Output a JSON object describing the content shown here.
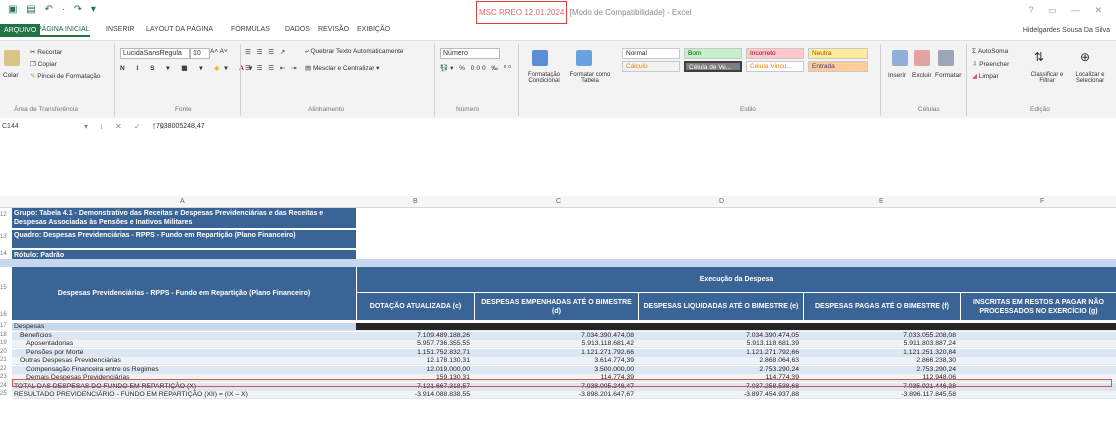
{
  "app": {
    "doc_title_highlight": "MSC RREO 12.01.2024",
    "doc_title_rest": " [Modo de Compatibilidade] - Excel",
    "user": "Hidelgardes Sousa Da Silva",
    "window_controls": "? ▭ — ✕"
  },
  "tabs": [
    "ARQUIVO",
    "PÁGINA INICIAL",
    "INSERIR",
    "LAYOUT DA PÁGINA",
    "FÓRMULAS",
    "DADOS",
    "REVISÃO",
    "EXIBIÇÃO"
  ],
  "ribbon": {
    "clipboard": {
      "cut": "Recortar",
      "copy": "Copiar",
      "paste": "Colar",
      "painter": "Pincel de Formatação",
      "group": "Área de Transferência"
    },
    "font": {
      "name": "LucidaSansRegula",
      "size": "10",
      "group": "Fonte"
    },
    "align": {
      "wrap": "Quebrar Texto Automaticamente",
      "merge": "Mesclar e Centralizar",
      "group": "Alinhamento"
    },
    "number": {
      "format": "Número",
      "group": "Número"
    },
    "styles": {
      "cond": "Formatação Condicional",
      "table": "Formatar como Tabela",
      "normal": "Normal",
      "good": "Bom",
      "bad": "Incorreto",
      "neutral": "Neutra",
      "calc": "Cálculo",
      "check": "Célula de Ve...",
      "linked": "Célula Vincu...",
      "input": "Entrada",
      "group": "Estilo"
    },
    "cells": {
      "insert": "Inserir",
      "delete": "Excluir",
      "format": "Formatar",
      "group": "Células"
    },
    "editing": {
      "autosum": "AutoSoma",
      "fill": "Preencher",
      "clear": "Limpar",
      "sort": "Classificar e Filtrar",
      "find": "Localizar e Selecionar",
      "group": "Edição"
    }
  },
  "formula_bar": {
    "name_box": "C144",
    "formula": "7038005248,47",
    "fx": "fx"
  },
  "columns": [
    "A",
    "B",
    "C",
    "D",
    "E",
    "F"
  ],
  "header_block": {
    "row_numbers": [
      "12",
      "13",
      "14"
    ],
    "group": "Grupo: Tabela 4.1 - Demonstrativo das Receitas e Despesas Previdenciárias e das Receitas e Despesas Associadas às Pensões e Inativos Militares",
    "quadro": "Quadro: Despesas Previdenciárias - RPPS - Fundo em Repartição (Plano Financeiro)",
    "rotulo": "Rótulo: Padrão"
  },
  "table_header": {
    "row_numbers": [
      "15",
      "16"
    ],
    "col_a": "Despesas Previdenciárias - RPPS - Fundo em Repartição (Plano Financeiro)",
    "execucao": "Execução da Despesa",
    "col_b": "DOTAÇÃO ATUALIZADA (c)",
    "col_c": "DESPESAS EMPENHADAS ATÉ O BIMESTRE (d)",
    "col_d": "DESPESAS LIQUIDADAS ATÉ O BIMESTRE (e)",
    "col_e": "DESPESAS PAGAS ATÉ O BIMESTRE (f)",
    "col_f": "INSCRITAS EM RESTOS A PAGAR NÃO PROCESSADOS NO EXERCÍCIO (g)"
  },
  "rows": [
    {
      "n": "17",
      "label": "Despesas",
      "b": "",
      "c": "",
      "d": "",
      "e": "",
      "indent": 0
    },
    {
      "n": "18",
      "label": "Benefícios",
      "b": "7.109.489.188,26",
      "c": "7.034.390.474,08",
      "d": "7.034.390.474,05",
      "e": "7.033.055.208,08",
      "indent": 1
    },
    {
      "n": "19",
      "label": "Aposentadorias",
      "b": "5.957.736.355,55",
      "c": "5.913.118.681,42",
      "d": "5.913.118.681,39",
      "e": "5.911.803.887,24",
      "indent": 2
    },
    {
      "n": "20",
      "label": "Pensões por Morte",
      "b": "1.151.752.832,71",
      "c": "1.121.271.792,66",
      "d": "1.121.271.792,66",
      "e": "1.121.251.320,84",
      "indent": 2
    },
    {
      "n": "21",
      "label": "Outras Despesas Previdenciárias",
      "b": "12.178.130,31",
      "c": "3.614.774,39",
      "d": "2.868.064,63",
      "e": "2.866.238,30",
      "indent": 1
    },
    {
      "n": "22",
      "label": "Compensação Financeira entre os Regimes",
      "b": "12.019.000,00",
      "c": "3.500.000,00",
      "d": "2.753.290,24",
      "e": "2.753.290,24",
      "indent": 2
    },
    {
      "n": "23",
      "label": "Demais Despesas Previdenciárias",
      "b": "159.130,31",
      "c": "114.774,39",
      "d": "114.774,39",
      "e": "112.948,06",
      "indent": 2
    },
    {
      "n": "24",
      "label": "TOTAL DAS DESPESAS DO FUNDO EM REPARTIÇÃO (X)",
      "b": "7.121.667.318,57",
      "c": "7.038.005.248,47",
      "d": "7.037.258.538,68",
      "e": "7.035.921.446,38",
      "indent": 0
    },
    {
      "n": "25",
      "label": "RESULTADO PREVIDENCIÁRIO - FUNDO EM REPARTIÇÃO (XII) = (IX – X)",
      "b": "-3.914.088.838,55",
      "c": "-3.898.201.647,67",
      "d": "-3.897.454.937,88",
      "e": "-3.896.117.845,58",
      "indent": 0
    }
  ]
}
